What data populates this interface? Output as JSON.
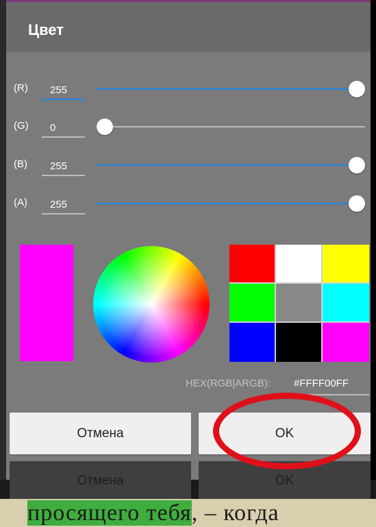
{
  "dialog": {
    "title": "Цвет",
    "channels": [
      {
        "label": "(R)",
        "value": "255",
        "level": 1.0
      },
      {
        "label": "(G)",
        "value": "0",
        "level": 0.0
      },
      {
        "label": "(B)",
        "value": "255",
        "level": 1.0
      },
      {
        "label": "(A)",
        "value": "255",
        "level": 1.0
      }
    ],
    "preview_color": "#FF00FF",
    "palette": [
      "#ff0000",
      "#ffffff",
      "#ffff00",
      "#00ff00",
      "#888888",
      "#00ffff",
      "#0000ff",
      "#000000",
      "#ff00ff"
    ],
    "hex_label": "HEX(RGB|ARGB):",
    "hex_value": "#FFFF00FF",
    "cancel_label": "Отмена",
    "ok_label": "OK"
  },
  "underlay": {
    "cancel_label": "Отмена",
    "ok_label": "OK",
    "text_highlight": "просящего тебя",
    "text_rest": ", – когда"
  },
  "colors": {
    "accent": "#1e88e5",
    "highlight_oval": "#e0101a"
  }
}
